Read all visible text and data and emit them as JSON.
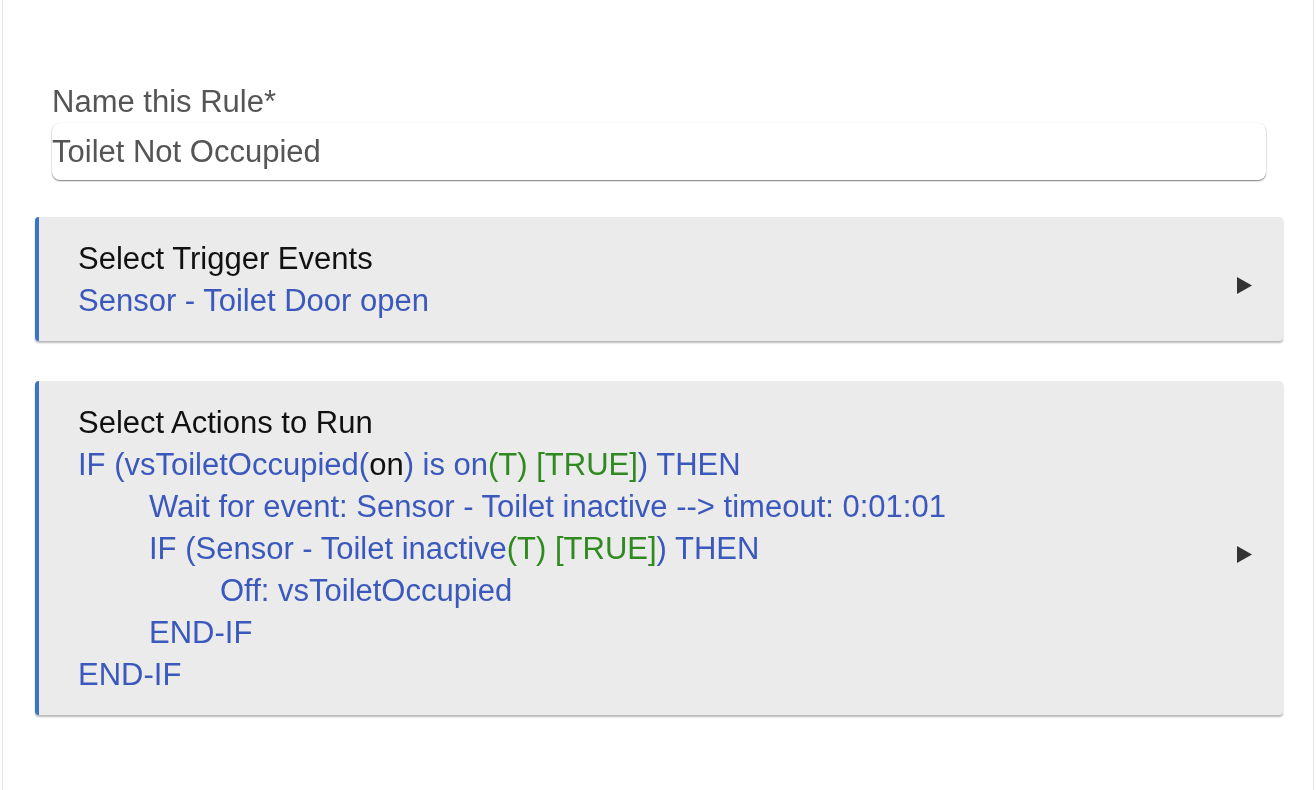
{
  "rule_name": {
    "label": "Name this Rule*",
    "value": "Toilet Not Occupied"
  },
  "sections": [
    {
      "title": "Select Trigger Events",
      "expanded": false,
      "lines": [
        {
          "parts": [
            {
              "kind": "plain",
              "text": "Sensor - Toilet Door open"
            }
          ]
        }
      ]
    },
    {
      "title": "Select Actions to Run",
      "expanded": false,
      "lines": [
        {
          "parts": [
            {
              "kind": "plain",
              "text": "IF (vsToiletOccupied("
            },
            {
              "kind": "state",
              "text": "on"
            },
            {
              "kind": "plain",
              "text": ") is on"
            },
            {
              "kind": "result",
              "text": "(T) [TRUE]"
            },
            {
              "kind": "plain",
              "text": ") THEN"
            }
          ],
          "children": [
            {
              "parts": [
                {
                  "kind": "plain",
                  "text": "Wait for event: Sensor - Toilet inactive --> timeout: 0:01:01"
                }
              ]
            },
            {
              "parts": [
                {
                  "kind": "plain",
                  "text": "IF (Sensor - Toilet inactive"
                },
                {
                  "kind": "result",
                  "text": "(T) [TRUE]"
                },
                {
                  "kind": "plain",
                  "text": ") THEN"
                }
              ],
              "children": [
                {
                  "parts": [
                    {
                      "kind": "plain",
                      "text": "Off: vsToiletOccupied"
                    }
                  ]
                }
              ]
            },
            {
              "parts": [
                {
                  "kind": "plain",
                  "text": "END-IF"
                }
              ]
            }
          ]
        },
        {
          "parts": [
            {
              "kind": "plain",
              "text": "END-IF"
            }
          ]
        }
      ]
    }
  ]
}
